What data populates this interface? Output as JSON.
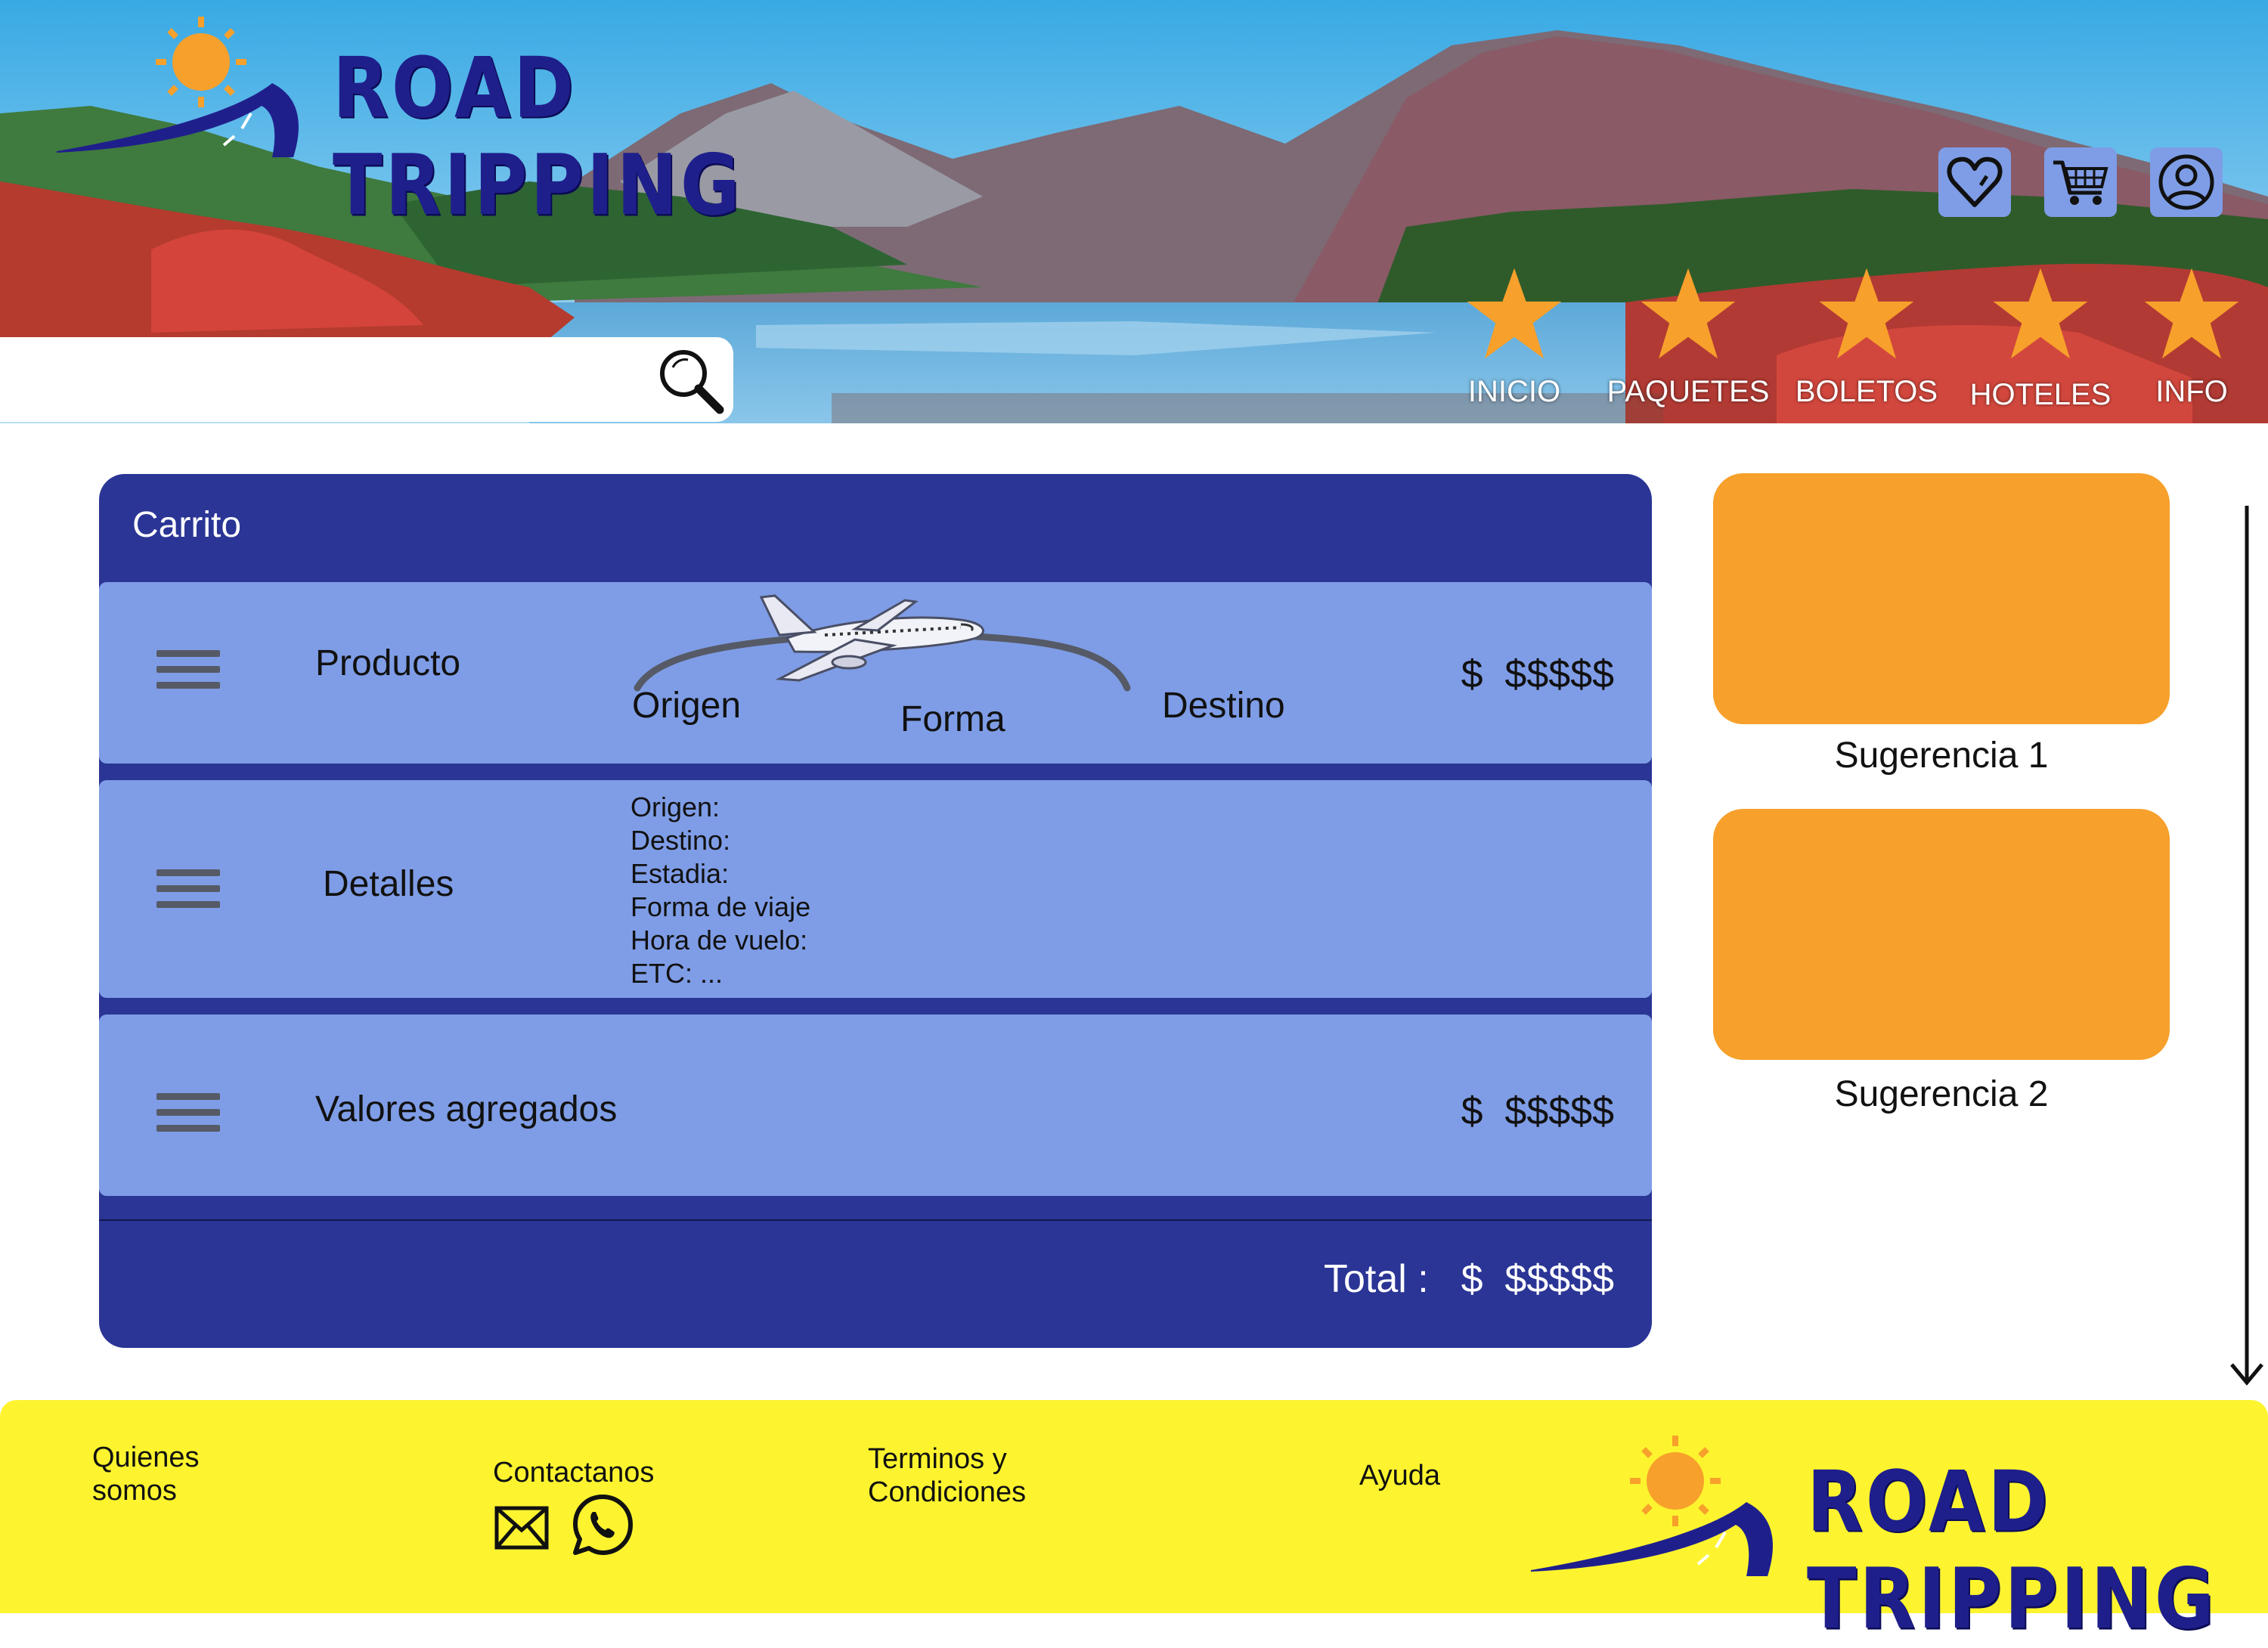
{
  "header": {
    "brand": "ROAD TRIPPING",
    "search": {
      "placeholder": "",
      "icon": "search-icon"
    },
    "actions": [
      {
        "name": "favorites",
        "icon": "heart-icon"
      },
      {
        "name": "cart",
        "icon": "cart-icon"
      },
      {
        "name": "account",
        "icon": "user-icon"
      }
    ],
    "nav": [
      {
        "label": "INICIO",
        "icon": "star-icon"
      },
      {
        "label": "PAQUETES",
        "icon": "star-icon"
      },
      {
        "label": "BOLETOS",
        "icon": "star-icon"
      },
      {
        "label": "HOTELES",
        "icon": "star-icon"
      },
      {
        "label": "INFO",
        "icon": "star-icon"
      }
    ]
  },
  "cart": {
    "title": "Carrito",
    "product": {
      "label": "Producto",
      "origin": "Origen",
      "mode": "Forma",
      "destination": "Destino",
      "price": "$  $$$$$",
      "icon": "airplane-icon"
    },
    "details": {
      "label": "Detalles",
      "lines": [
        "Origen:",
        "Destino:",
        "Estadia:",
        "Forma de viaje",
        "Hora de vuelo:",
        "ETC: ..."
      ]
    },
    "extras": {
      "label": "Valores agregados",
      "price": "$  $$$$$"
    },
    "total": {
      "label": "Total :",
      "value": "$  $$$$$"
    }
  },
  "suggestions": [
    {
      "label": "Sugerencia 1"
    },
    {
      "label": "Sugerencia 2"
    }
  ],
  "footer": {
    "about": "Quienes\nsomos",
    "contact": "Contactanos",
    "terms": "Terminos y\nCondiciones",
    "help": "Ayuda",
    "brand": "ROAD TRIPPING",
    "contact_icons": [
      "mail-icon",
      "whatsapp-icon"
    ]
  },
  "colors": {
    "navy": "#2a3595",
    "row_blue": "#7f9de6",
    "orange": "#f7a02b",
    "footer_yellow": "#fdf42f",
    "brand_blue": "#1f1f8c"
  }
}
